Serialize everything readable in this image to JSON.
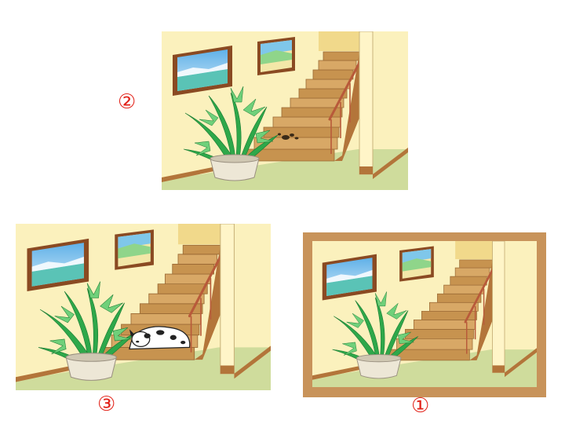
{
  "labels": {
    "scene_2": "②",
    "scene_3": "③",
    "scene_1": "①"
  },
  "colors": {
    "wall": "#fbf1bd",
    "floor": "#cfdc9c",
    "stair_wood": "#c7934f",
    "stair_top": "#e6bd7c",
    "baseboard": "#b3753a",
    "frame": "#8a4a22",
    "outer_frame": "#c8935a",
    "label_red": "#e2231a",
    "plant_green": "#2ea84a",
    "pot": "#ede7d6"
  },
  "scenes": [
    {
      "id": "2",
      "has_dog": false,
      "has_droppings": true,
      "has_outer_frame": false
    },
    {
      "id": "3",
      "has_dog": true,
      "has_droppings": false,
      "has_outer_frame": false
    },
    {
      "id": "1",
      "has_dog": false,
      "has_droppings": false,
      "has_outer_frame": true
    }
  ]
}
